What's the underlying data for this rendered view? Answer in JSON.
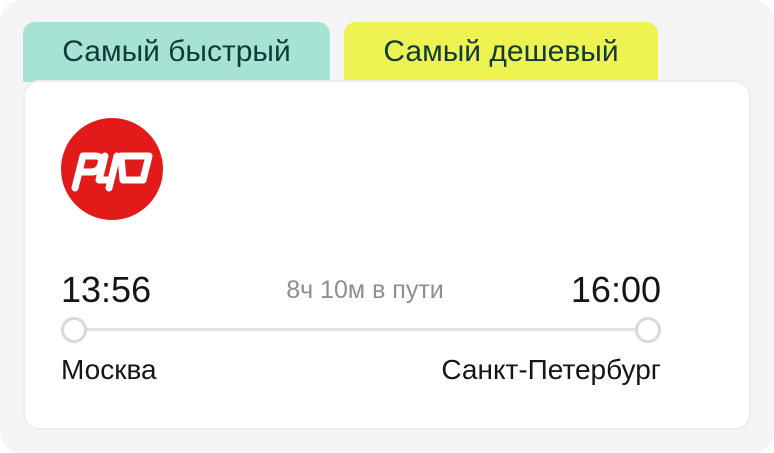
{
  "tabs": [
    {
      "label": "Самый быстрый",
      "color": "#a7e3d2"
    },
    {
      "label": "Самый дешевый",
      "color": "#eef352"
    }
  ],
  "carrier": {
    "logo_icon": "rzd-logo-icon",
    "logo_text": "РЖД",
    "logo_color": "#e21a1a"
  },
  "trip": {
    "departure_time": "13:56",
    "arrival_time": "16:00",
    "duration": "8ч 10м в пути",
    "departure_city": "Москва",
    "arrival_city": "Санкт-Петербург"
  }
}
